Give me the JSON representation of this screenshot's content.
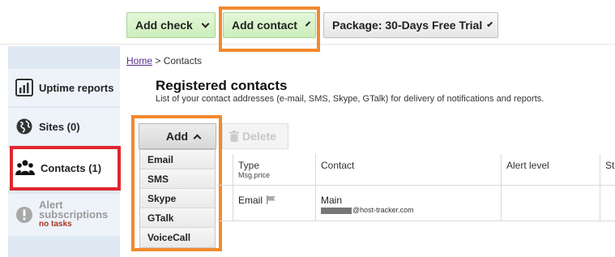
{
  "toolbar": {
    "add_check": "Add check",
    "add_contact": "Add contact",
    "package": "Package: 30-Days Free Trial"
  },
  "sidebar": {
    "items": [
      {
        "label": "Uptime reports",
        "icon": "bar-chart-icon"
      },
      {
        "label": "Sites (0)",
        "icon": "globe-icon"
      },
      {
        "label": "Contacts (1)",
        "icon": "people-icon"
      },
      {
        "label": "Alert subscriptions",
        "sub": "no tasks",
        "icon": "alert-icon"
      }
    ]
  },
  "breadcrumb": {
    "home": "Home",
    "sep": " > ",
    "current": "Contacts"
  },
  "page": {
    "title": "Registered contacts",
    "description": "List of your contact addresses (e-mail, SMS, Skype, GTalk) for delivery of notifications and reports."
  },
  "actions": {
    "add_label": "Add",
    "delete_label": "Delete",
    "add_menu": [
      "Email",
      "SMS",
      "Skype",
      "GTalk",
      "VoiceCall"
    ]
  },
  "table": {
    "headers": {
      "type": "Type",
      "type_sub": "Msg.price",
      "contact": "Contact",
      "alert_level": "Alert level",
      "status_partial": "St"
    },
    "rows": [
      {
        "type": "Email",
        "contact_name": "Main",
        "contact_address_suffix": "@host-tracker.com"
      }
    ]
  },
  "colors": {
    "highlight_orange": "#f28a2e",
    "highlight_red": "#e0262f",
    "toolbar_green": "#d4f1c6",
    "sidebar_bg": "#dfe9f3"
  }
}
